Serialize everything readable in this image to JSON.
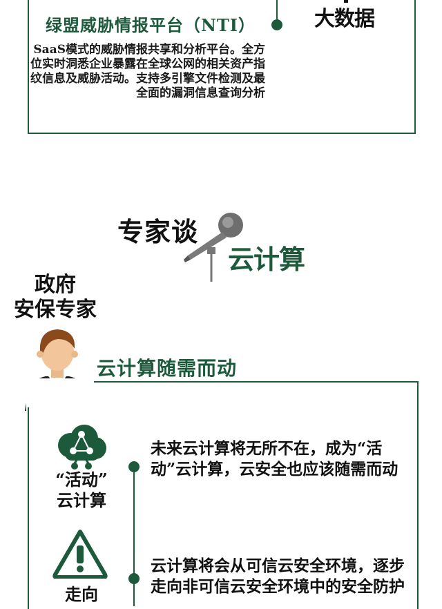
{
  "top_card": {
    "title": "绿盟威胁情报平台（NTI）",
    "description": "SaaS模式的威胁情报共享和分析平台。全方位实时洞悉企业暴露在全球公网的相关资产指纹信息及威胁活动。支持多引擎文件检测及最全面的漏洞信息查询分析",
    "side_label": "大数据"
  },
  "header": {
    "expert_talk": "专家谈",
    "topic": "云计算",
    "mic_icon": "microphone-icon"
  },
  "expert": {
    "role_line1": "政府",
    "role_line2": "安保专家",
    "avatar_icon": "businessman-avatar-icon"
  },
  "section": {
    "heading": "云计算随需而动",
    "items": [
      {
        "icon": "cloud-network-icon",
        "label_line1": "“活动”",
        "label_line2": "云计算",
        "text": "未来云计算将无所不在，成为“活动”云计算，云安全也应该随需而动"
      },
      {
        "icon": "warning-icon",
        "label_line1": "走向",
        "text": "云计算将会从可信云安全环境，逐步走向非可信云安全环境中的安全防护"
      }
    ]
  },
  "colors": {
    "accent": "#1d5a3c",
    "text": "#1a1a1a"
  }
}
